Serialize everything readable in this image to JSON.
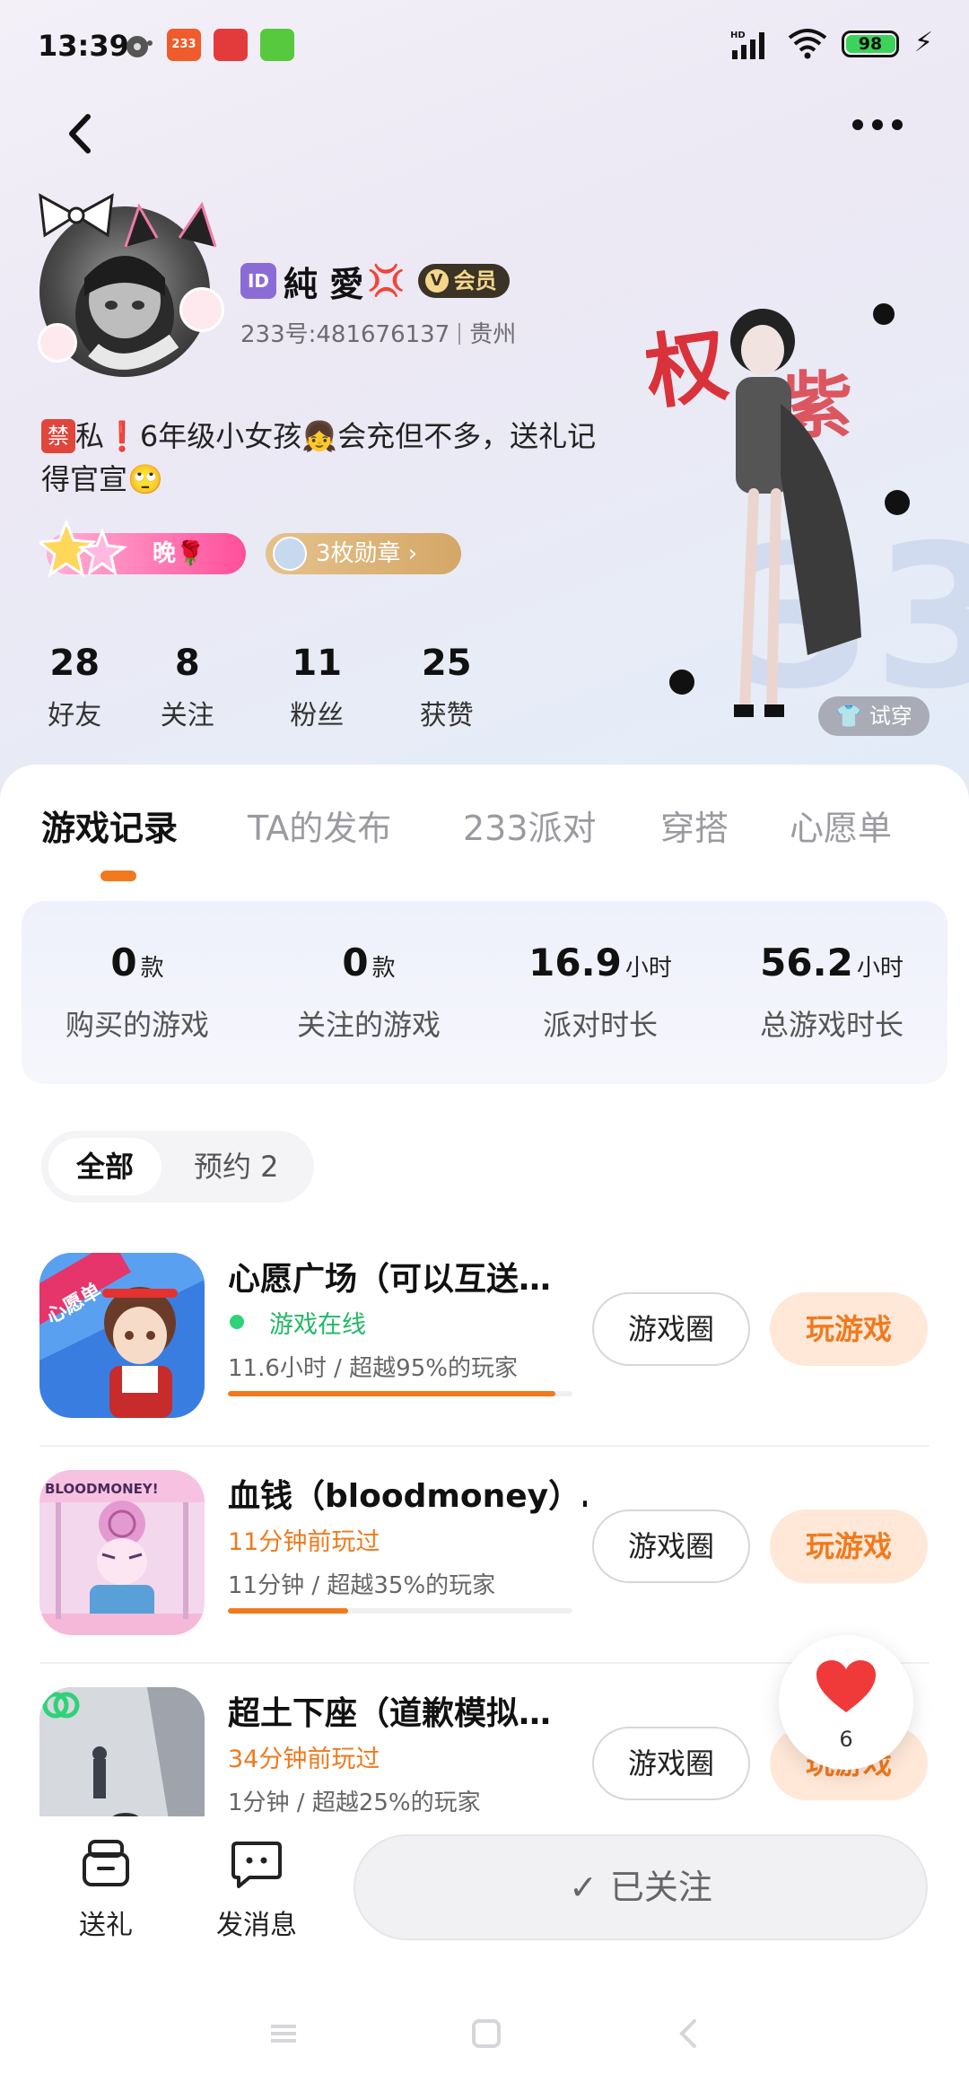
{
  "status_bar": {
    "time": "13:39",
    "notif_icons": [
      "music-disc-icon",
      "app-233-icon",
      "app-red-icon",
      "app-green-icon"
    ],
    "app_233_label": "233",
    "battery": "98",
    "network": "HD"
  },
  "profile": {
    "id_badge": "ID",
    "name": "純 愛",
    "vip_label": "会员",
    "uid": "233号:481676137",
    "location": "贵州",
    "bio_ban": "禁",
    "bio_line1": "私",
    "bio_line1_rest": "6年级小女孩👧会充但不多，送礼记",
    "bio_line2": "得官宣🙄",
    "pill_evening": "晚🌹",
    "pill_medals": "3枚勋章 ›",
    "try_on": "试穿"
  },
  "stats": [
    {
      "num": "28",
      "label": "好友"
    },
    {
      "num": "8",
      "label": "关注"
    },
    {
      "num": "11",
      "label": "粉丝"
    },
    {
      "num": "25",
      "label": "获赞"
    }
  ],
  "tabs": [
    "游戏记录",
    "TA的发布",
    "233派对",
    "穿搭",
    "心愿单"
  ],
  "summary": [
    {
      "num": "0",
      "unit": "款",
      "label": "购买的游戏"
    },
    {
      "num": "0",
      "unit": "款",
      "label": "关注的游戏"
    },
    {
      "num": "16.9",
      "unit": "小时",
      "label": "派对时长"
    },
    {
      "num": "56.2",
      "unit": "小时",
      "label": "总游戏时长"
    }
  ],
  "filter": {
    "all": "全部",
    "reserve": "预约 2"
  },
  "games": [
    {
      "title": "心愿广场（可以互送…",
      "status": "游戏在线",
      "time": "11.6小时 / 超越95%的玩家",
      "progress": 0.95,
      "circle": "游戏圈",
      "play": "玩游戏",
      "icon_label": "心愿单"
    },
    {
      "title": "血钱（bloodmoney）…",
      "status": "11分钟前玩过",
      "time": "11分钟 / 超越35%的玩家",
      "progress": 0.35,
      "circle": "游戏圈",
      "play": "玩游戏",
      "icon_label": "BLOODMONEY!"
    },
    {
      "title": "超土下座（道歉模拟…",
      "status": "34分钟前玩过",
      "time": "1分钟 / 超越25%的玩家",
      "progress": 0.25,
      "circle": "游戏圈",
      "play": "玩游戏"
    }
  ],
  "favorite": {
    "count": "6"
  },
  "bottom": {
    "gift": "送礼",
    "message": "发消息",
    "followed": "已关注"
  },
  "colors": {
    "accent": "#f07a1d",
    "online": "#22b866",
    "vip_bg": "#3a3326",
    "vip_text": "#f5d78c"
  }
}
